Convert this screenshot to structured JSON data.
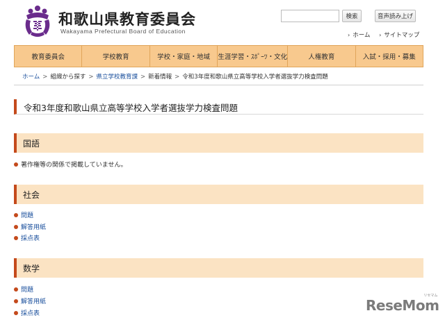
{
  "header": {
    "org_name": "和歌山県教育委員会",
    "org_sub": "Wakayama Prefectural Board of Education",
    "search_placeholder": "",
    "search_button": "検索",
    "voice_button": "音声読み上げ",
    "util_links": [
      "ホーム",
      "サイトマップ"
    ]
  },
  "nav": {
    "items": [
      "教育委員会",
      "学校教育",
      "学校・家庭・地域",
      "生涯学習・ｽﾎﾟｰﾂ・文化",
      "人権教育",
      "入試・採用・募集"
    ]
  },
  "breadcrumb": {
    "items": [
      "ホーム",
      "組織から探す",
      "県立学校教育課",
      "新着情報",
      "令和3年度和歌山県立高等学校入学者選抜学力検査問題"
    ]
  },
  "page": {
    "title": "令和3年度和歌山県立高等学校入学者選抜学力検査問題"
  },
  "sections": [
    {
      "label": "国語",
      "items": [
        "著作権等の関係で掲載していません。"
      ]
    },
    {
      "label": "社会",
      "items": [
        "問題",
        "解答用紙",
        "採点表"
      ]
    },
    {
      "label": "数学",
      "items": [
        "問題",
        "解答用紙",
        "採点表"
      ]
    }
  ],
  "watermark": {
    "text": "ReseMom",
    "small": "リセマム"
  },
  "colors": {
    "accent": "#c44a1c",
    "nav_bg": "#f8c98e",
    "section_bg": "#fbe3c3",
    "link": "#1a4f9c"
  }
}
